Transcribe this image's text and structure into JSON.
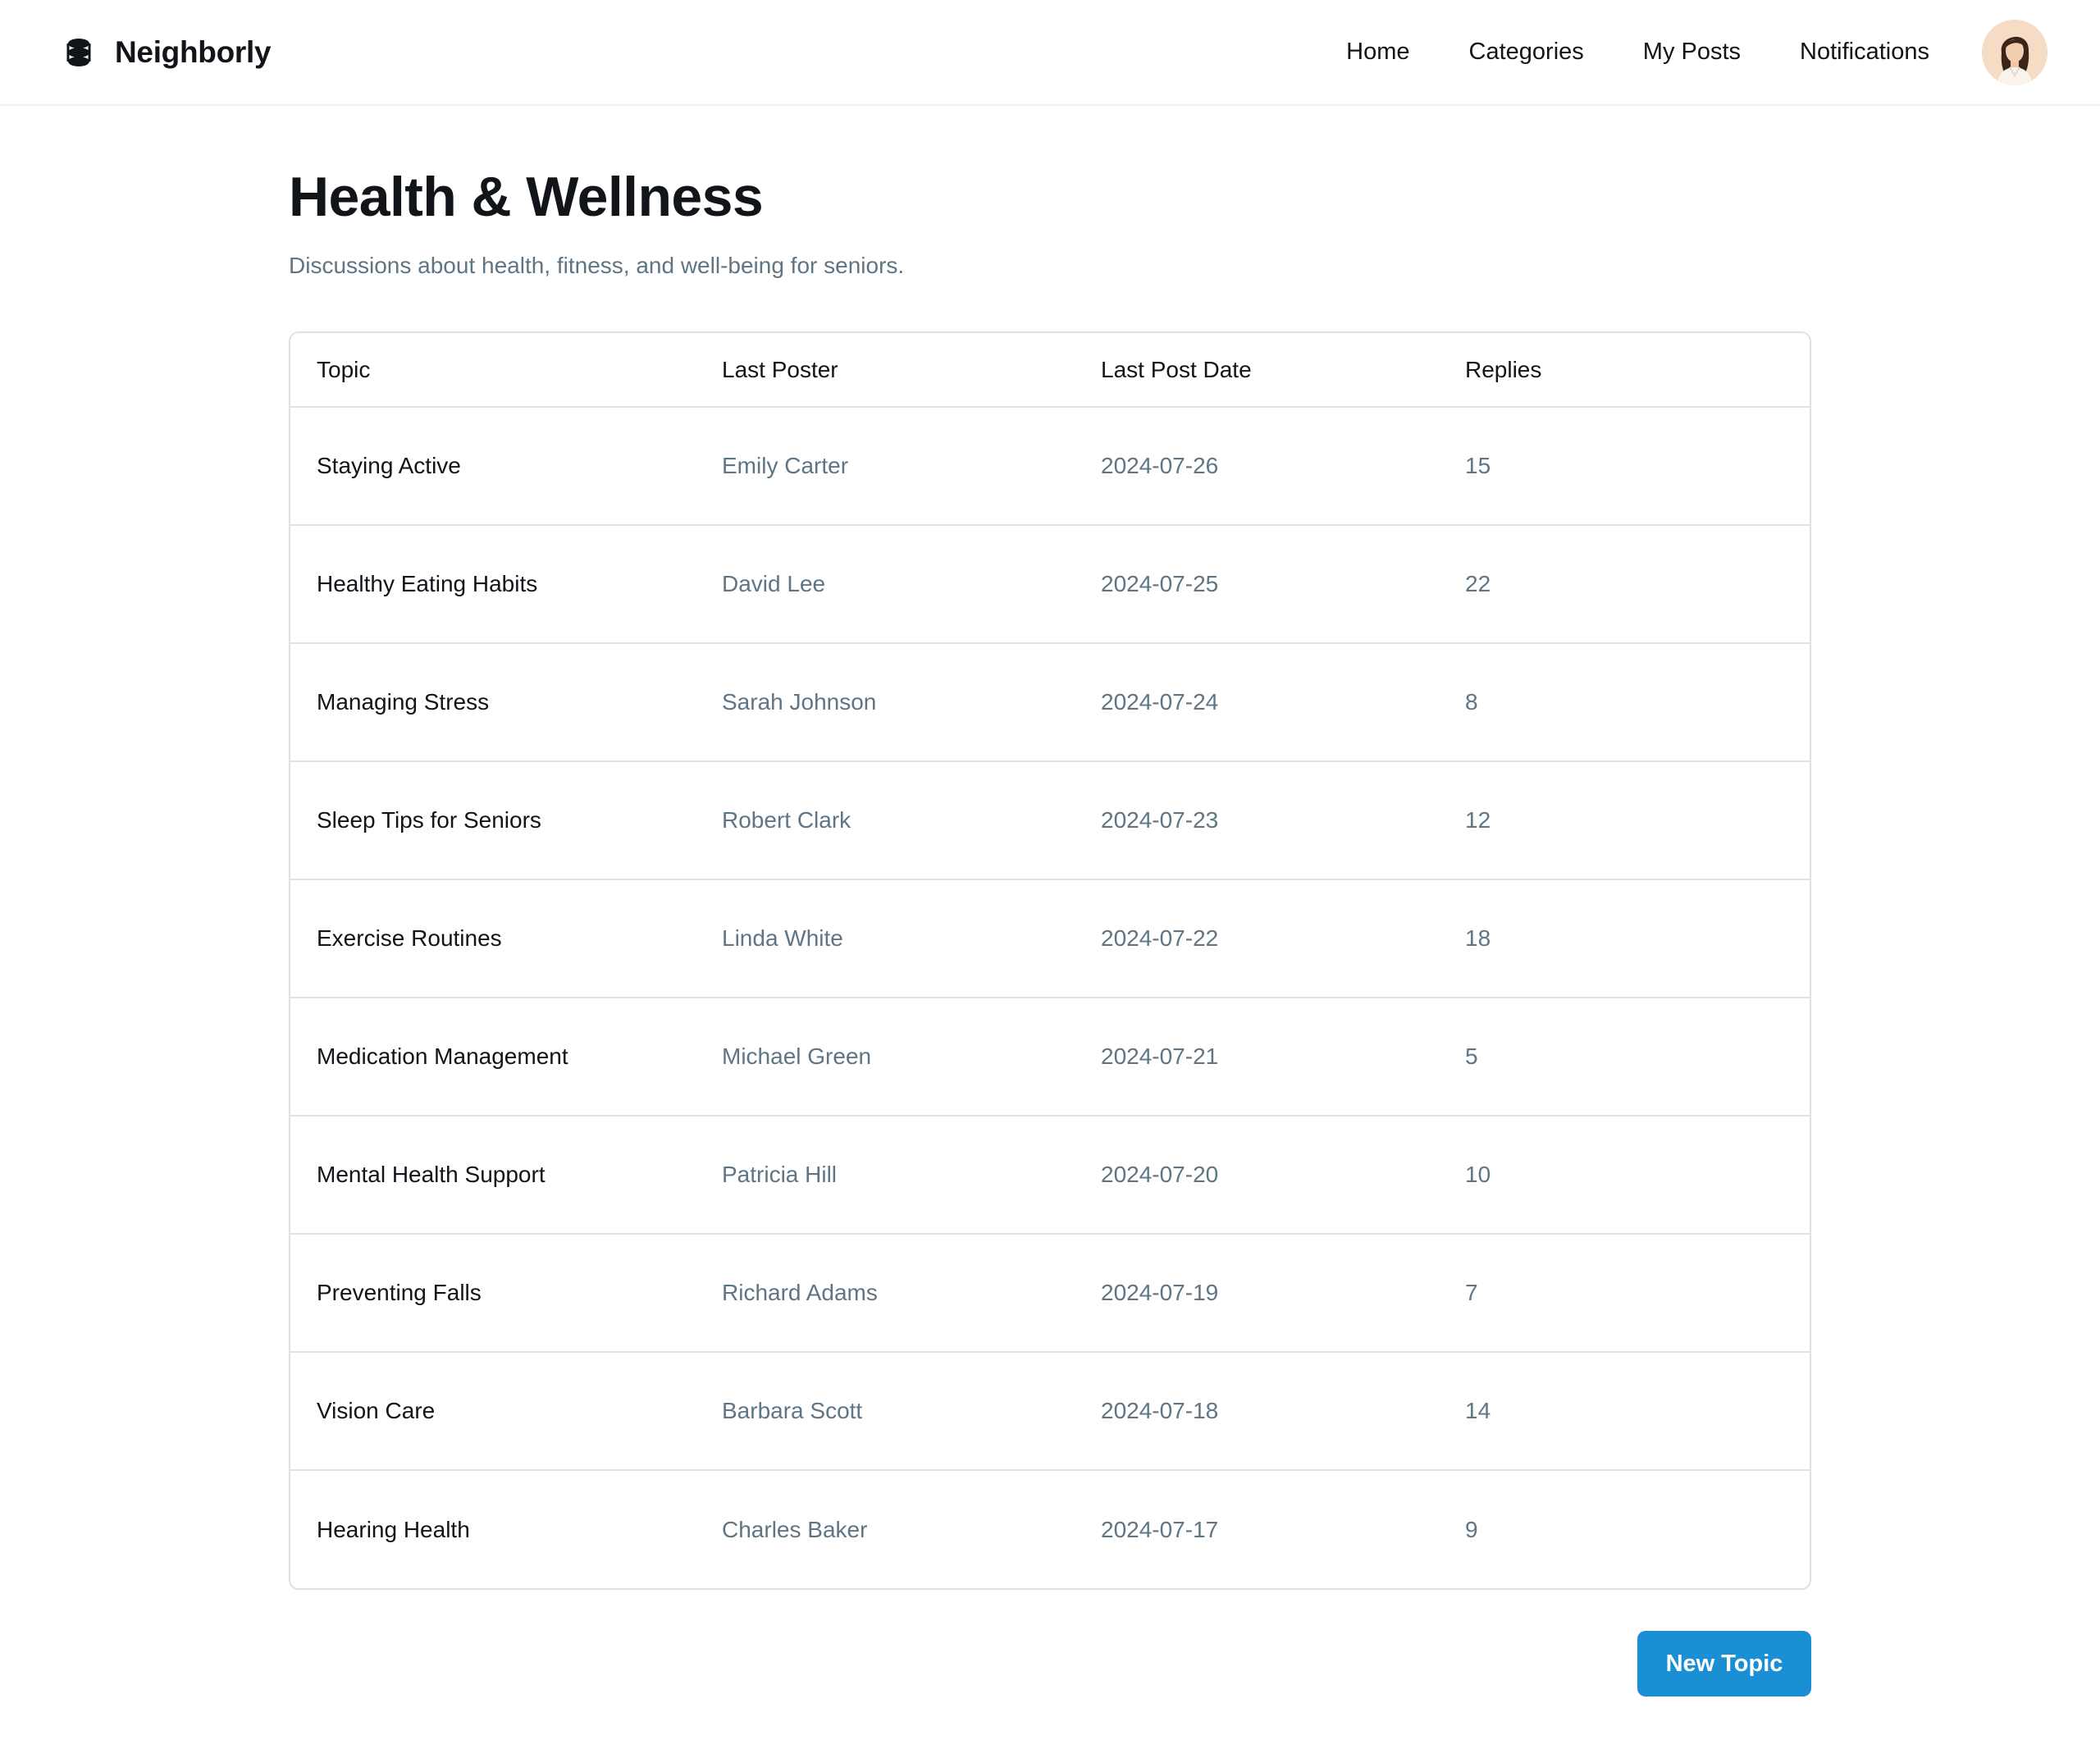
{
  "header": {
    "brand_name": "Neighborly",
    "logo_icon": "stack-logo-icon",
    "nav": [
      {
        "label": "Home"
      },
      {
        "label": "Categories"
      },
      {
        "label": "My Posts"
      },
      {
        "label": "Notifications"
      }
    ],
    "avatar_icon": "user-avatar"
  },
  "page": {
    "title": "Health & Wellness",
    "subtitle": "Discussions about health, fitness, and well-being for seniors."
  },
  "table": {
    "columns": [
      "Topic",
      "Last Poster",
      "Last Post Date",
      "Replies"
    ],
    "rows": [
      {
        "topic": "Staying Active",
        "poster": "Emily Carter",
        "date": "2024-07-26",
        "replies": "15"
      },
      {
        "topic": "Healthy Eating Habits",
        "poster": "David Lee",
        "date": "2024-07-25",
        "replies": "22"
      },
      {
        "topic": "Managing Stress",
        "poster": "Sarah Johnson",
        "date": "2024-07-24",
        "replies": "8"
      },
      {
        "topic": "Sleep Tips for Seniors",
        "poster": "Robert Clark",
        "date": "2024-07-23",
        "replies": "12"
      },
      {
        "topic": "Exercise Routines",
        "poster": "Linda White",
        "date": "2024-07-22",
        "replies": "18"
      },
      {
        "topic": "Medication Management",
        "poster": "Michael Green",
        "date": "2024-07-21",
        "replies": "5"
      },
      {
        "topic": "Mental Health Support",
        "poster": "Patricia Hill",
        "date": "2024-07-20",
        "replies": "10"
      },
      {
        "topic": "Preventing Falls",
        "poster": "Richard Adams",
        "date": "2024-07-19",
        "replies": "7"
      },
      {
        "topic": "Vision Care",
        "poster": "Barbara Scott",
        "date": "2024-07-18",
        "replies": "14"
      },
      {
        "topic": "Hearing Health",
        "poster": "Charles Baker",
        "date": "2024-07-17",
        "replies": "9"
      }
    ]
  },
  "actions": {
    "new_topic_label": "New Topic"
  },
  "colors": {
    "accent": "#1a8fd4",
    "muted_text": "#5f7584",
    "border": "#dde1e5"
  }
}
